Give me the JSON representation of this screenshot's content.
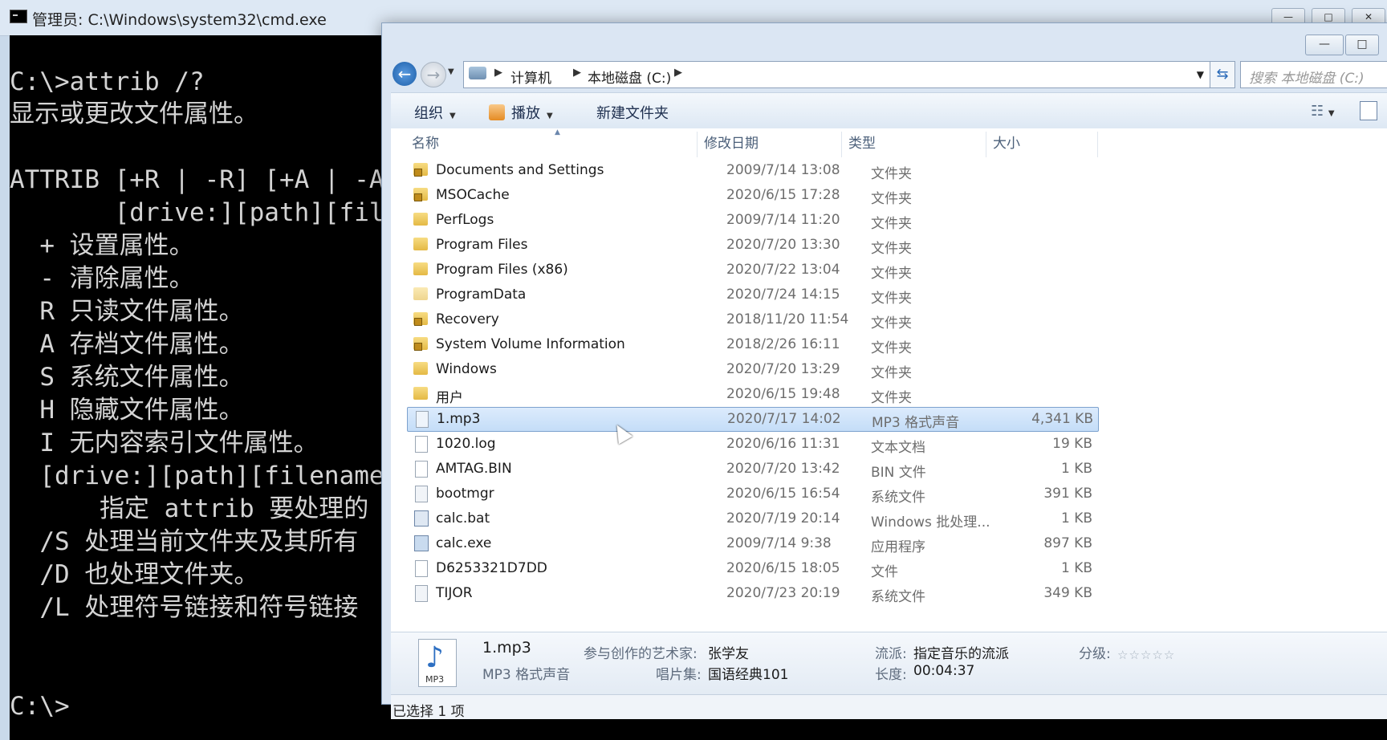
{
  "cmd": {
    "title": "管理员: C:\\Windows\\system32\\cmd.exe",
    "lines": [
      "C:\\>attrib /?",
      "显示或更改文件属性。",
      "",
      "ATTRIB [+R | -R] [+A | -A",
      "       [drive:][path][file",
      "  + 设置属性。",
      "  - 清除属性。",
      "  R 只读文件属性。",
      "  A 存档文件属性。",
      "  S 系统文件属性。",
      "  H 隐藏文件属性。",
      "  I 无内容索引文件属性。",
      "  [drive:][path][filename]",
      "      指定 attrib 要处理的",
      "  /S 处理当前文件夹及其所有",
      "  /D 也处理文件夹。",
      "  /L 处理符号链接和符号链接",
      "",
      "",
      "C:\\>"
    ]
  },
  "explorer": {
    "address": {
      "crumbs": [
        "计算机",
        "本地磁盘 (C:)"
      ],
      "search_placeholder": "搜索 本地磁盘 (C:)"
    },
    "toolbar": {
      "organize": "组织",
      "play": "播放",
      "new_folder": "新建文件夹"
    },
    "columns": {
      "name": "名称",
      "date": "修改日期",
      "type": "类型",
      "size": "大小"
    },
    "rows": [
      {
        "name": "Documents and Settings",
        "date": "2009/7/14 13:08",
        "type": "文件夹",
        "size": "",
        "icon": "folder-lock-icon"
      },
      {
        "name": "MSOCache",
        "date": "2020/6/15 17:28",
        "type": "文件夹",
        "size": "",
        "icon": "folder-lock-icon"
      },
      {
        "name": "PerfLogs",
        "date": "2009/7/14 11:20",
        "type": "文件夹",
        "size": "",
        "icon": "folder-icon"
      },
      {
        "name": "Program Files",
        "date": "2020/7/20 13:30",
        "type": "文件夹",
        "size": "",
        "icon": "folder-icon"
      },
      {
        "name": "Program Files (x86)",
        "date": "2020/7/22 13:04",
        "type": "文件夹",
        "size": "",
        "icon": "folder-icon"
      },
      {
        "name": "ProgramData",
        "date": "2020/7/24 14:15",
        "type": "文件夹",
        "size": "",
        "icon": "folder-icon"
      },
      {
        "name": "Recovery",
        "date": "2018/11/20 11:54",
        "type": "文件夹",
        "size": "",
        "icon": "folder-lock-icon"
      },
      {
        "name": "System Volume Information",
        "date": "2018/2/26 16:11",
        "type": "文件夹",
        "size": "",
        "icon": "folder-lock-icon"
      },
      {
        "name": "Windows",
        "date": "2020/7/20 13:29",
        "type": "文件夹",
        "size": "",
        "icon": "folder-icon"
      },
      {
        "name": "用户",
        "date": "2020/6/15 19:48",
        "type": "文件夹",
        "size": "",
        "icon": "folder-icon"
      },
      {
        "name": "1.mp3",
        "date": "2020/7/17 14:02",
        "type": "MP3 格式声音",
        "size": "4,341 KB",
        "icon": "audio-file-icon",
        "selected": true
      },
      {
        "name": "1020.log",
        "date": "2020/6/16 11:31",
        "type": "文本文档",
        "size": "19 KB",
        "icon": "text-file-icon"
      },
      {
        "name": "AMTAG.BIN",
        "date": "2020/7/20 13:42",
        "type": "BIN 文件",
        "size": "1 KB",
        "icon": "file-icon"
      },
      {
        "name": "bootmgr",
        "date": "2020/6/15 16:54",
        "type": "系统文件",
        "size": "391 KB",
        "icon": "system-file-icon"
      },
      {
        "name": "calc.bat",
        "date": "2020/7/19 20:14",
        "type": "Windows 批处理...",
        "size": "1 KB",
        "icon": "batch-file-icon"
      },
      {
        "name": "calc.exe",
        "date": "2009/7/14 9:38",
        "type": "应用程序",
        "size": "897 KB",
        "icon": "calculator-icon"
      },
      {
        "name": "D6253321D7DD",
        "date": "2020/6/15 18:05",
        "type": "文件",
        "size": "1 KB",
        "icon": "file-icon"
      },
      {
        "name": "TIJOR",
        "date": "2020/7/23 20:19",
        "type": "系统文件",
        "size": "349 KB",
        "icon": "system-file-icon"
      }
    ],
    "details": {
      "filename": "1.mp3",
      "filetype": "MP3 格式声音",
      "artist_label": "参与创作的艺术家:",
      "artist": "张学友",
      "album_label": "唱片集:",
      "album": "国语经典101",
      "genre_label": "流派:",
      "genre": "指定音乐的流派",
      "length_label": "长度:",
      "length": "00:04:37",
      "rating_label": "分级:",
      "rating": "☆☆☆☆☆",
      "icon_label": "MP3"
    },
    "status": "已选择 1 项"
  }
}
